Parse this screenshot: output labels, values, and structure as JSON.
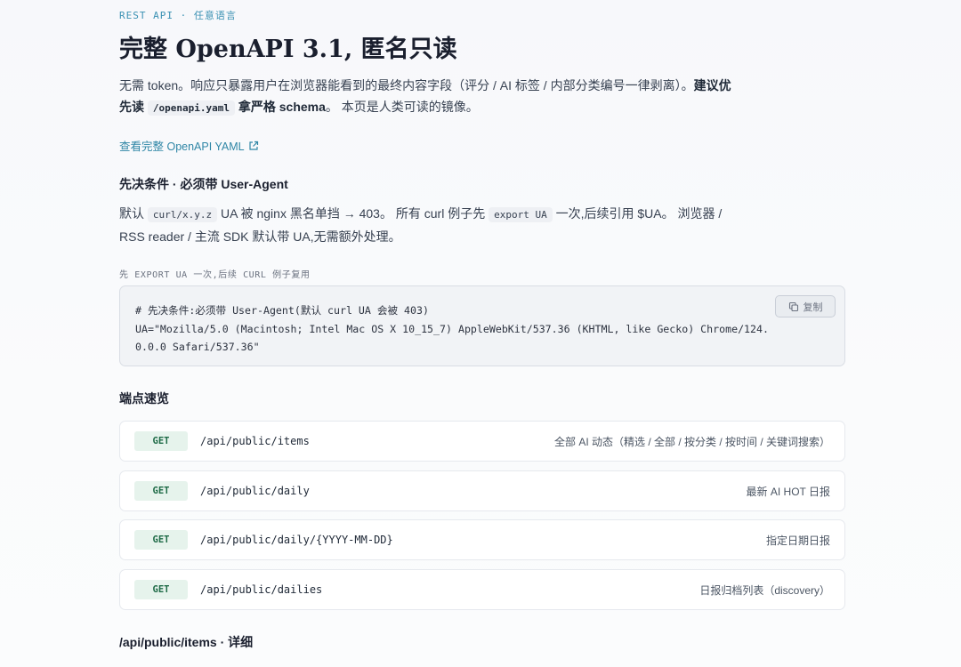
{
  "kicker": "REST API · 任意语言",
  "title": "完整 OpenAPI 3.1, 匿名只读",
  "intro": {
    "part1": "无需 token。响应只暴露用户在浏览器能看到的最终内容字段（评分 / AI 标签 / 内部分类编号一律剥离）。",
    "bold1": "建议优先读",
    "code": "/openapi.yaml",
    "bold2": "拿严格 schema",
    "part2": "。 本页是人类可读的镜像。"
  },
  "yaml_link": "查看完整 OpenAPI YAML",
  "prereq": {
    "heading": "先决条件 · 必须带 User-Agent",
    "t1": "默认",
    "code1": "curl/x.y.z",
    "t2": "UA 被 nginx 黑名单挡 → 403。 所有 curl 例子先",
    "code2": "export UA",
    "t3": "一次,后续引用 $UA。 浏览器 / RSS reader / 主流 SDK 默认带 UA,无需额外处理。"
  },
  "code_block": {
    "label": "先 EXPORT UA 一次,后续 CURL 例子复用",
    "line1": "# 先决条件:必须带 User-Agent(默认 curl UA 会被 403)",
    "line2": "UA=\"Mozilla/5.0 (Macintosh; Intel Mac OS X 10_15_7) AppleWebKit/537.36 (KHTML, like Gecko) Chrome/124.0.0.0 Safari/537.36\"",
    "copy_label": "复制"
  },
  "endpoints_heading": "端点速览",
  "endpoints": [
    {
      "method": "GET",
      "path": "/api/public/items",
      "desc": "全部 AI 动态（精选 / 全部 / 按分类 / 按时间 / 关键词搜索）"
    },
    {
      "method": "GET",
      "path": "/api/public/daily",
      "desc": "最新 AI HOT 日报"
    },
    {
      "method": "GET",
      "path": "/api/public/daily/{YYYY-MM-DD}",
      "desc": "指定日期日报"
    },
    {
      "method": "GET",
      "path": "/api/public/dailies",
      "desc": "日报归档列表（discovery）"
    }
  ],
  "detail_heading": "/api/public/items · 详细"
}
